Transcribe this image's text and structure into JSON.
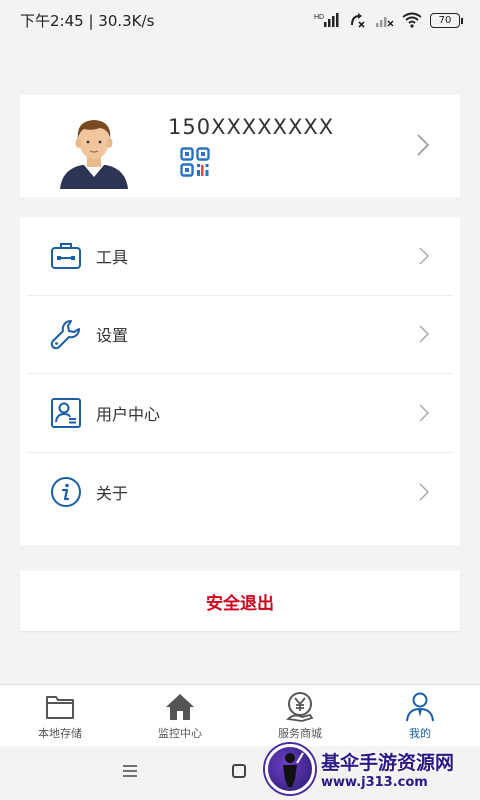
{
  "status_bar": {
    "time_speed": "下午2:45 | 30.3K/s",
    "hd_label": "HD",
    "battery": "70"
  },
  "profile": {
    "phone": "150XXXXXXXX"
  },
  "menu": {
    "items": [
      {
        "label": "工具",
        "icon": "toolbox-icon"
      },
      {
        "label": "设置",
        "icon": "wrench-icon"
      },
      {
        "label": "用户中心",
        "icon": "user-card-icon"
      },
      {
        "label": "关于",
        "icon": "info-icon"
      }
    ]
  },
  "logout": {
    "label": "安全退出"
  },
  "tabs": [
    {
      "label": "本地存储",
      "icon": "folder-icon",
      "active": false
    },
    {
      "label": "监控中心",
      "icon": "home-icon",
      "active": false
    },
    {
      "label": "服务商城",
      "icon": "yuan-shop-icon",
      "active": false
    },
    {
      "label": "我的",
      "icon": "profile-icon",
      "active": true
    }
  ],
  "watermark": {
    "title": "基伞手游资源网",
    "url": "www.j313.com"
  },
  "colors": {
    "accent_blue": "#1a5fa8",
    "logout_red": "#d0021b",
    "background": "#f3f3f3"
  }
}
